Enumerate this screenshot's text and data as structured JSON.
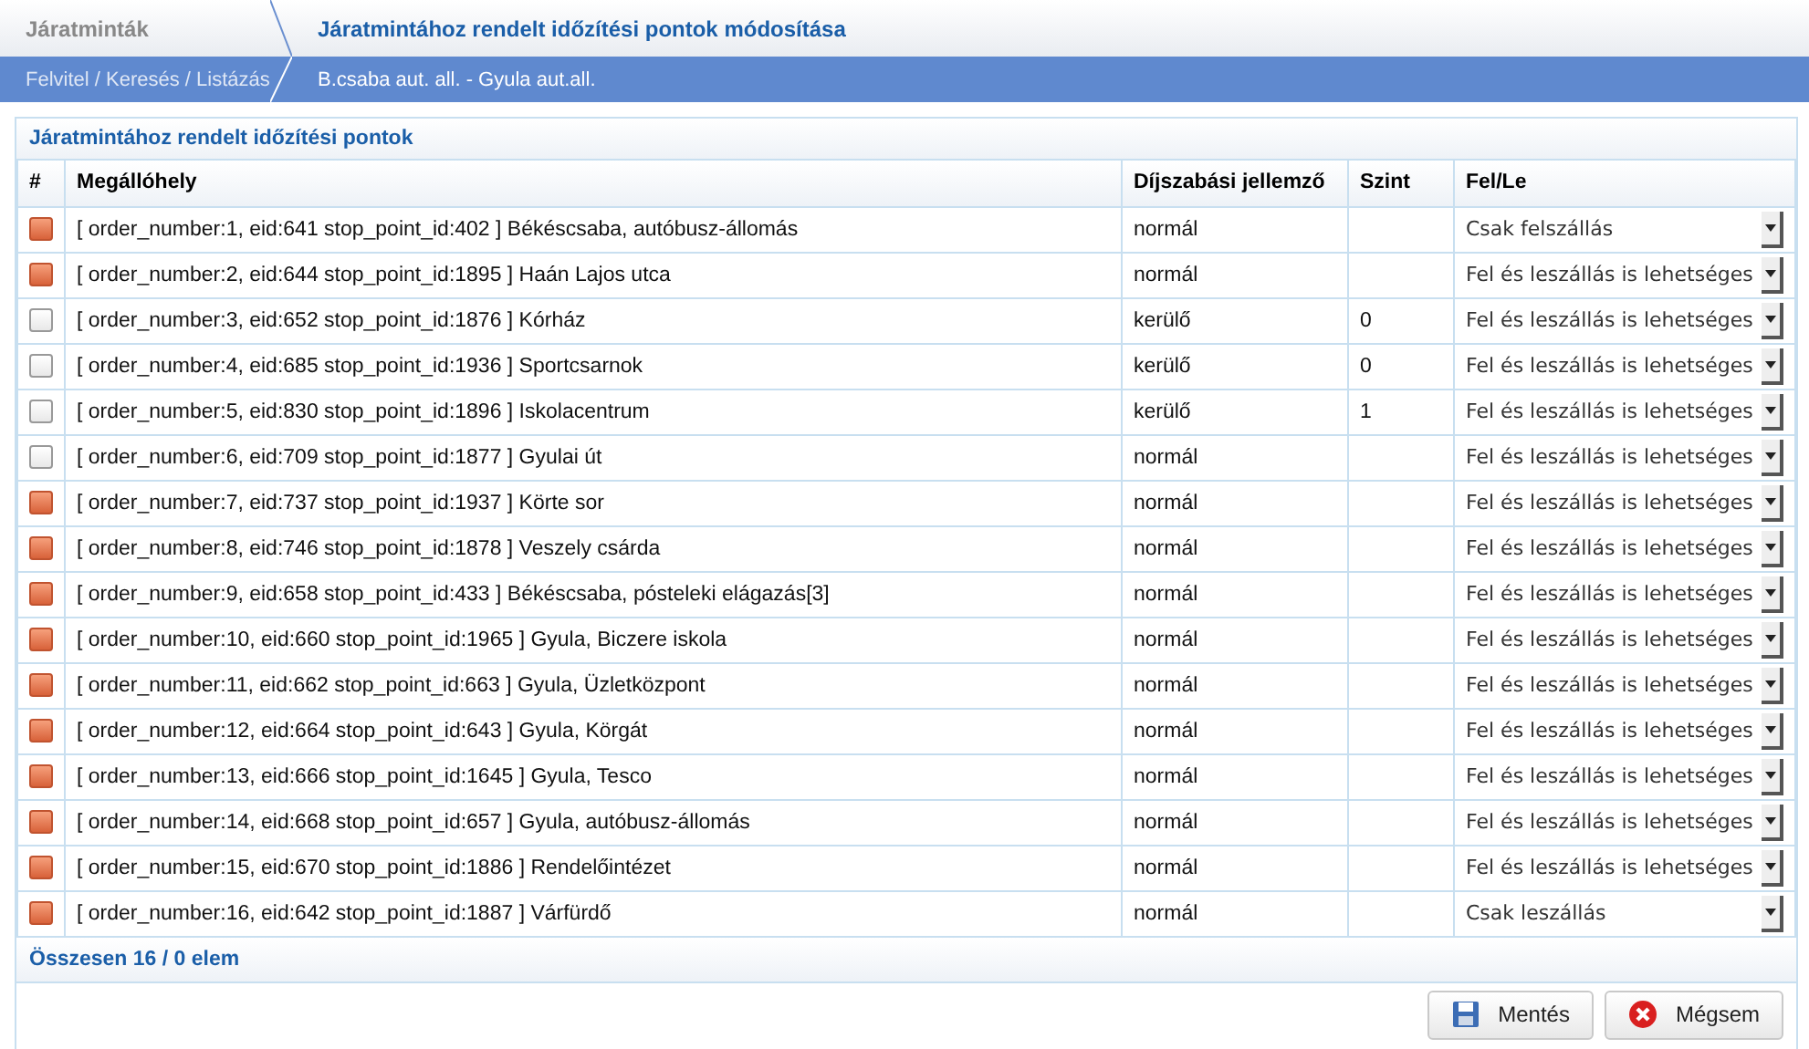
{
  "tabs": [
    {
      "label": "Járatminták",
      "selected": false
    },
    {
      "label": "Járatmintához rendelt időzítési pontok módosítása",
      "selected": true
    }
  ],
  "breadcrumbs": [
    "Felvitel / Keresés / Listázás",
    "B.csaba aut. all. - Gyula aut.all."
  ],
  "panel": {
    "title": "Járatmintához rendelt időzítési pontok",
    "columns": [
      "#",
      "Megállóhely",
      "Díjszabási jellemző",
      "Szint",
      "Fel/Le"
    ],
    "rows": [
      {
        "checked": true,
        "stop": "[ order_number:1, eid:641 stop_point_id:402 ] Békéscsaba, autóbusz-állomás",
        "fare": "normál",
        "level": "",
        "mode": "Csak felszállás"
      },
      {
        "checked": true,
        "stop": "[ order_number:2, eid:644 stop_point_id:1895 ] Haán Lajos utca",
        "fare": "normál",
        "level": "",
        "mode": "Fel és leszállás is lehetséges"
      },
      {
        "checked": false,
        "stop": "[ order_number:3, eid:652 stop_point_id:1876 ] Kórház",
        "fare": "kerülő",
        "level": "0",
        "mode": "Fel és leszállás is lehetséges"
      },
      {
        "checked": false,
        "stop": "[ order_number:4, eid:685 stop_point_id:1936 ] Sportcsarnok",
        "fare": "kerülő",
        "level": "0",
        "mode": "Fel és leszállás is lehetséges"
      },
      {
        "checked": false,
        "stop": "[ order_number:5, eid:830 stop_point_id:1896 ] Iskolacentrum",
        "fare": "kerülő",
        "level": "1",
        "mode": "Fel és leszállás is lehetséges"
      },
      {
        "checked": false,
        "stop": "[ order_number:6, eid:709 stop_point_id:1877 ] Gyulai út",
        "fare": "normál",
        "level": "",
        "mode": "Fel és leszállás is lehetséges"
      },
      {
        "checked": true,
        "stop": "[ order_number:7, eid:737 stop_point_id:1937 ] Körte sor",
        "fare": "normál",
        "level": "",
        "mode": "Fel és leszállás is lehetséges"
      },
      {
        "checked": true,
        "stop": "[ order_number:8, eid:746 stop_point_id:1878 ] Veszely csárda",
        "fare": "normál",
        "level": "",
        "mode": "Fel és leszállás is lehetséges"
      },
      {
        "checked": true,
        "stop": "[ order_number:9, eid:658 stop_point_id:433 ] Békéscsaba, pósteleki elágazás[3]",
        "fare": "normál",
        "level": "",
        "mode": "Fel és leszállás is lehetséges"
      },
      {
        "checked": true,
        "stop": "[ order_number:10, eid:660 stop_point_id:1965 ] Gyula, Biczere iskola",
        "fare": "normál",
        "level": "",
        "mode": "Fel és leszállás is lehetséges"
      },
      {
        "checked": true,
        "stop": "[ order_number:11, eid:662 stop_point_id:663 ] Gyula, Üzletközpont",
        "fare": "normál",
        "level": "",
        "mode": "Fel és leszállás is lehetséges"
      },
      {
        "checked": true,
        "stop": "[ order_number:12, eid:664 stop_point_id:643 ] Gyula, Körgát",
        "fare": "normál",
        "level": "",
        "mode": "Fel és leszállás is lehetséges"
      },
      {
        "checked": true,
        "stop": "[ order_number:13, eid:666 stop_point_id:1645 ] Gyula, Tesco",
        "fare": "normál",
        "level": "",
        "mode": "Fel és leszállás is lehetséges"
      },
      {
        "checked": true,
        "stop": "[ order_number:14, eid:668 stop_point_id:657 ] Gyula, autóbusz-állomás",
        "fare": "normál",
        "level": "",
        "mode": "Fel és leszállás is lehetséges"
      },
      {
        "checked": true,
        "stop": "[ order_number:15, eid:670 stop_point_id:1886 ] Rendelőintézet",
        "fare": "normál",
        "level": "",
        "mode": "Fel és leszállás is lehetséges"
      },
      {
        "checked": true,
        "stop": "[ order_number:16, eid:642 stop_point_id:1887 ] Várfürdő",
        "fare": "normál",
        "level": "",
        "mode": "Csak leszállás"
      }
    ],
    "summary": "Összesen 16 / 0 elem",
    "buttons": [
      {
        "kind": "save",
        "label": "Mentés"
      },
      {
        "kind": "cancel",
        "label": "Mégsem"
      }
    ]
  }
}
